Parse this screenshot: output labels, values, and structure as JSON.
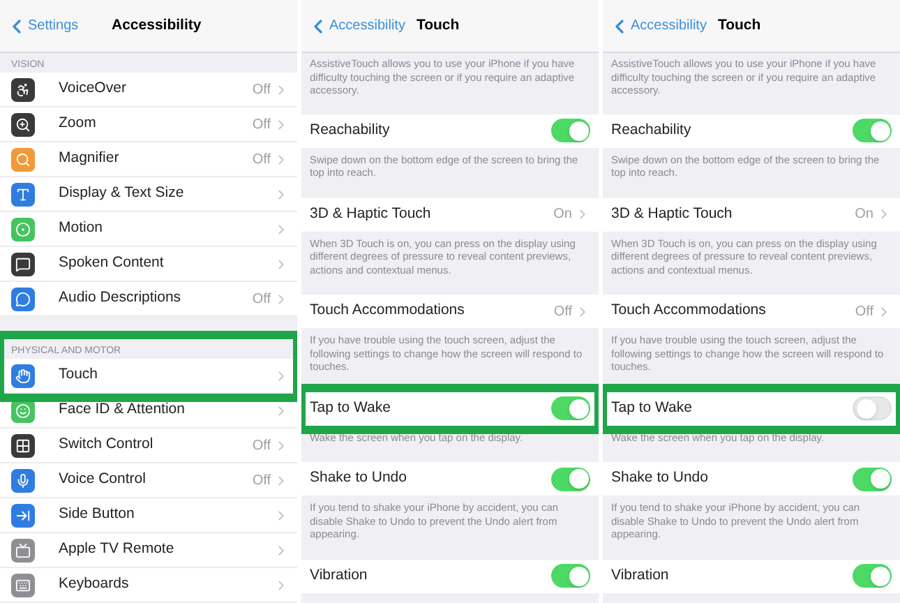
{
  "accessibility_screen": {
    "back": "Settings",
    "title": "Accessibility",
    "sections": [
      {
        "header": "VISION",
        "highlighted": false,
        "items": [
          {
            "label": "VoiceOver",
            "value": "Off",
            "color": "#3a3a3c"
          },
          {
            "label": "Zoom",
            "value": "Off",
            "color": "#3a3a3c"
          },
          {
            "label": "Magnifier",
            "value": "Off",
            "color": "#f19a37"
          },
          {
            "label": "Display & Text Size",
            "color": "#2f7de1"
          },
          {
            "label": "Motion",
            "color": "#45c45f"
          },
          {
            "label": "Spoken Content",
            "color": "#3a3a3c"
          },
          {
            "label": "Audio Descriptions",
            "value": "Off",
            "color": "#2f7de1"
          }
        ]
      },
      {
        "header": "PHYSICAL AND MOTOR",
        "highlighted": true,
        "items": [
          {
            "label": "Touch",
            "color": "#2f7de1"
          },
          {
            "label": "Face ID & Attention",
            "color": "#45c45f"
          },
          {
            "label": "Switch Control",
            "value": "Off",
            "color": "#3a3a3c"
          },
          {
            "label": "Voice Control",
            "value": "Off",
            "color": "#2f7de1"
          },
          {
            "label": "Side Button",
            "color": "#2f7de1"
          },
          {
            "label": "Apple TV Remote",
            "color": "#8e8e93"
          },
          {
            "label": "Keyboards",
            "color": "#8e8e93"
          }
        ]
      }
    ]
  },
  "touch_screens": [
    {
      "back": "Accessibility",
      "title": "Touch",
      "intro": "AssistiveTouch allows you to use your iPhone if you have difficulty touching the screen or if you require an adaptive accessory.",
      "rows": [
        {
          "label": "Reachability",
          "kind": "toggle",
          "on": true,
          "highlighted": false,
          "footer": "Swipe down on the bottom edge of the screen to bring the top into reach."
        },
        {
          "label": "3D & Haptic Touch",
          "kind": "link",
          "value": "On",
          "highlighted": false,
          "footer": "When 3D Touch is on, you can press on the display using different degrees of pressure to reveal content previews, actions and contextual menus."
        },
        {
          "label": "Touch Accommodations",
          "kind": "link",
          "value": "Off",
          "highlighted": false,
          "footer": "If you have trouble using the touch screen, adjust the following settings to change how the screen will respond to touches."
        },
        {
          "label": "Tap to Wake",
          "kind": "toggle",
          "on": true,
          "highlighted": true,
          "footer": "Wake the screen when you tap on the display."
        },
        {
          "label": "Shake to Undo",
          "kind": "toggle",
          "on": true,
          "highlighted": false,
          "footer": "If you tend to shake your iPhone by accident, you can disable Shake to Undo to prevent the Undo alert from appearing."
        },
        {
          "label": "Vibration",
          "kind": "toggle",
          "on": true,
          "highlighted": false
        }
      ]
    },
    {
      "back": "Accessibility",
      "title": "Touch",
      "intro": "AssistiveTouch allows you to use your iPhone if you have difficulty touching the screen or if you require an adaptive accessory.",
      "rows": [
        {
          "label": "Reachability",
          "kind": "toggle",
          "on": true,
          "highlighted": false,
          "footer": "Swipe down on the bottom edge of the screen to bring the top into reach."
        },
        {
          "label": "3D & Haptic Touch",
          "kind": "link",
          "value": "On",
          "highlighted": false,
          "footer": "When 3D Touch is on, you can press on the display using different degrees of pressure to reveal content previews, actions and contextual menus."
        },
        {
          "label": "Touch Accommodations",
          "kind": "link",
          "value": "Off",
          "highlighted": false,
          "footer": "If you have trouble using the touch screen, adjust the following settings to change how the screen will respond to touches."
        },
        {
          "label": "Tap to Wake",
          "kind": "toggle",
          "on": false,
          "highlighted": true,
          "footer": "Wake the screen when you tap on the display."
        },
        {
          "label": "Shake to Undo",
          "kind": "toggle",
          "on": true,
          "highlighted": false,
          "footer": "If you tend to shake your iPhone by accident, you can disable Shake to Undo to prevent the Undo alert from appearing."
        },
        {
          "label": "Vibration",
          "kind": "toggle",
          "on": true,
          "highlighted": false
        }
      ]
    }
  ]
}
